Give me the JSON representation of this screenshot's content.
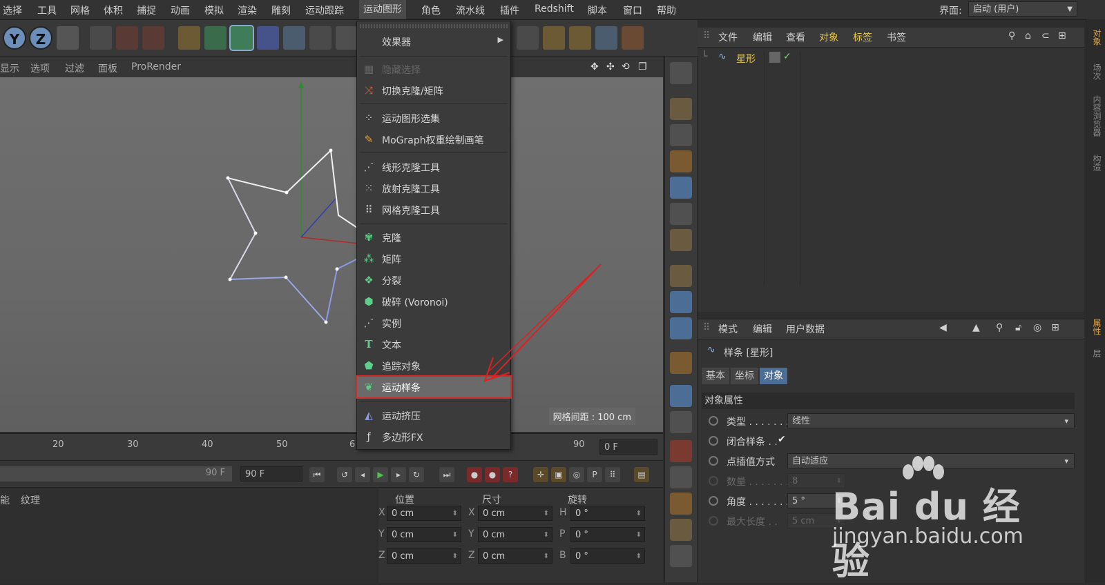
{
  "menubar": {
    "items": [
      "选择",
      "工具",
      "网格",
      "体积",
      "捕捉",
      "动画",
      "模拟",
      "渲染",
      "雕刻",
      "运动跟踪",
      "运动图形",
      "角色",
      "流水线",
      "插件",
      "Redshift",
      "脚本",
      "窗口",
      "帮助"
    ],
    "active": "运动图形",
    "interface_label": "界面:",
    "interface_value": "启动 (用户)"
  },
  "viewport": {
    "header": [
      "显示",
      "选项",
      "过滤",
      "面板",
      "ProRender"
    ],
    "grid_spacing": "网格间距 : 100 cm"
  },
  "timeline": {
    "ticks": [
      "20",
      "30",
      "40",
      "50",
      "6",
      "90"
    ],
    "current_frame": "0 F",
    "slider_end": "90 F",
    "end_frame": "90 F"
  },
  "materials": {
    "tabs": [
      "能",
      "纹理"
    ]
  },
  "coordinates": {
    "headers": [
      "位置",
      "尺寸",
      "旋转"
    ],
    "position": [
      {
        "axis": "X",
        "value": "0 cm"
      },
      {
        "axis": "Y",
        "value": "0 cm"
      },
      {
        "axis": "Z",
        "value": "0 cm"
      }
    ],
    "size": [
      {
        "axis": "X",
        "value": "0 cm"
      },
      {
        "axis": "Y",
        "value": "0 cm"
      },
      {
        "axis": "Z",
        "value": "0 cm"
      }
    ],
    "rotation": [
      {
        "axis": "H",
        "value": "0 °"
      },
      {
        "axis": "P",
        "value": "0 °"
      },
      {
        "axis": "B",
        "value": "0 °"
      }
    ]
  },
  "object_manager": {
    "menu": [
      "文件",
      "编辑",
      "查看",
      "对象",
      "标签",
      "书签"
    ],
    "object_name": "星形"
  },
  "attributes": {
    "menu": [
      "模式",
      "编辑",
      "用户数据"
    ],
    "title": "样条 [星形]",
    "tabs": [
      "基本",
      "坐标",
      "对象"
    ],
    "active_tab": "对象",
    "section": "对象属性",
    "props": [
      {
        "label": "类型 . . . . . . .",
        "value": "线性"
      },
      {
        "label": "闭合样条 . .",
        "value": "✔"
      },
      {
        "label": "点插值方式",
        "value": "自动适应"
      },
      {
        "label": "数量 . . . . . . .",
        "value": "8"
      },
      {
        "label": "角度 . . . . . . .",
        "value": "5 °"
      },
      {
        "label": "最大长度 . .",
        "value": "5 cm"
      }
    ]
  },
  "right_tabs": [
    "对象",
    "场次",
    "内容浏览器",
    "构造",
    "属性",
    "层"
  ],
  "menu": {
    "items": [
      {
        "label": "效果器",
        "submenu": true
      },
      {
        "label": "隐藏选择",
        "disabled": true
      },
      {
        "label": "切换克隆/矩阵"
      },
      {
        "label": "运动图形选集"
      },
      {
        "label": "MoGraph权重绘制画笔"
      },
      {
        "label": "线形克隆工具"
      },
      {
        "label": "放射克隆工具"
      },
      {
        "label": "网格克隆工具"
      },
      {
        "label": "克隆"
      },
      {
        "label": "矩阵"
      },
      {
        "label": "分裂"
      },
      {
        "label": "破碎 (Voronoi)"
      },
      {
        "label": "实例"
      },
      {
        "label": "文本"
      },
      {
        "label": "追踪对象"
      },
      {
        "label": "运动样条",
        "highlighted": true
      },
      {
        "label": "运动挤压"
      },
      {
        "label": "多边形FX"
      }
    ]
  },
  "watermark": {
    "brand": "Bai du 经验",
    "url": "jingyan.baidu.com"
  },
  "colors": {
    "highlight_border": "#d42a2a",
    "accent_blue": "#4c6e96",
    "object_yellow": "#e6c84a",
    "arrow_red": "#e02020"
  }
}
